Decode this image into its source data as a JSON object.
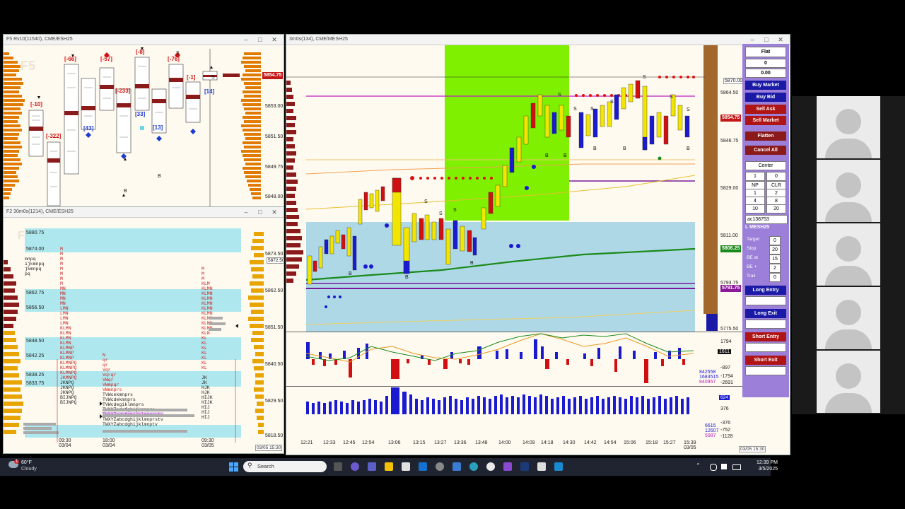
{
  "window_left_top": {
    "title": "F5 Rv10(11540), CME/ESH25",
    "watermark": "F5"
  },
  "window_left_bottom": {
    "title": "F2 30m0s(1214), CME/ESH25",
    "watermark": "F2"
  },
  "window_main": {
    "title": "3m0s(134), CME/MESH25"
  },
  "left_top_prices": [
    "5853.00",
    "5851.50",
    "5849.75",
    "5848.00"
  ],
  "left_top_current": "5854.75",
  "delta_labels": [
    "[-10]",
    "[-322]",
    "[-66]",
    "[-57]",
    "[-233]",
    "[-8]",
    "[-76]",
    "[-1]"
  ],
  "delta_labels_blue": [
    "[43]",
    "[33]",
    "[13]",
    "[14]"
  ],
  "left_bottom_levels": [
    "5880.75",
    "5874.00",
    "5862.75",
    "5856.50",
    "5848.50",
    "5842.25",
    "5838.25",
    "5833.75"
  ],
  "left_bottom_axis": [
    "5873.50",
    "5862.50",
    "5851.50",
    "5840.50",
    "5829.50",
    "5818.50"
  ],
  "left_bottom_axis_tag": "5872.50",
  "left_bottom_xlabels": [
    {
      "time": "09:30",
      "date": "03/04"
    },
    {
      "time": "18:00",
      "date": "03/04"
    },
    {
      "time": "09:30",
      "date": "03/05"
    }
  ],
  "left_bottom_corner": "03/05 15:30",
  "tpo_rows": [
    "TWXYZcdefghijkmnprs",
    "TWXYZcdefghijklmnprstv",
    "TWXYZabcdghijklmnprstv",
    "TWXYZabcdghijklmnptv"
  ],
  "main_axis": [
    "5870.00",
    "5864.50",
    "5846.75",
    "5829.00",
    "5811.00",
    "5793.75",
    "5775.50"
  ],
  "main_tags": {
    "current": "5854.75",
    "green": "5806.25",
    "purple": "5791.75"
  },
  "main_xlabels": [
    "12:21",
    "12:33",
    "12:45",
    "12:54",
    "13:06",
    "13:15",
    "13:27",
    "13:36",
    "13:48",
    "14:00",
    "14:09",
    "14:18",
    "14:30",
    "14:42",
    "14:54",
    "15:06",
    "15:18",
    "15:27",
    "15:39"
  ],
  "main_xdate": "03/05",
  "main_corner": "03/05 15:30",
  "osc1_axis": [
    "1794",
    "1611",
    "-897",
    "-1794",
    "-2691"
  ],
  "osc1_readouts": [
    "842558",
    "1683515",
    "840957"
  ],
  "osc2_axis": [
    "376",
    "-376",
    "-752",
    "-1128"
  ],
  "osc2_readouts": [
    "6615",
    "12607",
    "5987"
  ],
  "osc2_tag": "624",
  "trade_panel": {
    "position": "Flat",
    "qty": "0",
    "pnl": "0.00",
    "buy_market": "Buy Market",
    "buy_bid": "Buy Bid",
    "sell_ask": "Sell Ask",
    "sell_market": "Sell Market",
    "flatten": "Flatten",
    "cancel_all": "Cancel All",
    "center": "Center",
    "qty_input": "1",
    "qty_input2": "0",
    "np": "NP",
    "clr": "CLR",
    "grid": [
      "1",
      "2",
      "4",
      "8",
      "10",
      "20"
    ],
    "account": "ac138753",
    "symbol": "L MESH25",
    "target_label": "Target",
    "target": "0",
    "stop_label": "Stop",
    "stop": "20",
    "beat_label": "BE at",
    "beat": "15",
    "beplus_label": "BE +",
    "beplus": "2",
    "trail_label": "Trail",
    "trail": "0",
    "long_entry": "Long Entry",
    "long_exit": "Long Exit",
    "short_entry": "Short Entry",
    "short_exit": "Short Exit"
  },
  "taskbar": {
    "temp": "60°F",
    "weather": "Cloudy",
    "search": "Search",
    "time": "12:39 PM",
    "date": "3/5/2025",
    "badge": "1"
  },
  "colors": {
    "panel": "#9b7fd9",
    "buy": "#1a1aa6",
    "sell": "#b01515",
    "highlight": "#7ff000",
    "band": "#aee8ee"
  }
}
